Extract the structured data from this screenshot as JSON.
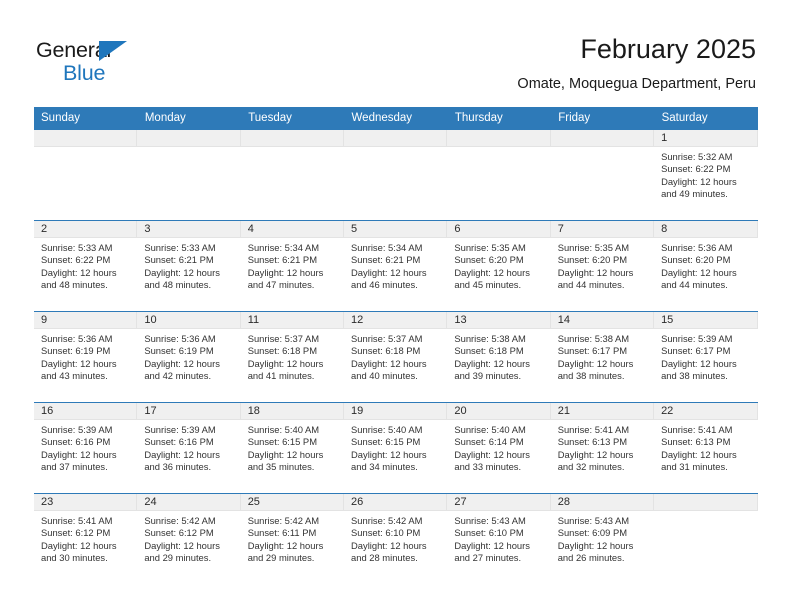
{
  "logo": {
    "primary_text": "General",
    "secondary_text": "Blue",
    "triangle_icon": "triangle-icon",
    "primary_color": "#1a1a1a",
    "accent_color": "#1f76bc"
  },
  "header": {
    "title": "February 2025",
    "subtitle": "Omate, Moquegua Department, Peru"
  },
  "theme": {
    "header_blue": "#2e7ab8",
    "daynum_band": "#f0f0f0",
    "cell_background": "#ffffff",
    "text_color": "#333333"
  },
  "calendar": {
    "weekday_headers": [
      "Sunday",
      "Monday",
      "Tuesday",
      "Wednesday",
      "Thursday",
      "Friday",
      "Saturday"
    ],
    "labels": {
      "sunrise": "Sunrise:",
      "sunset": "Sunset:",
      "daylight": "Daylight:"
    },
    "weeks": [
      [
        {
          "day": "",
          "info": ""
        },
        {
          "day": "",
          "info": ""
        },
        {
          "day": "",
          "info": ""
        },
        {
          "day": "",
          "info": ""
        },
        {
          "day": "",
          "info": ""
        },
        {
          "day": "",
          "info": ""
        },
        {
          "day": "1",
          "info": "Sunrise: 5:32 AM\nSunset: 6:22 PM\nDaylight: 12 hours\nand 49 minutes."
        }
      ],
      [
        {
          "day": "2",
          "info": "Sunrise: 5:33 AM\nSunset: 6:22 PM\nDaylight: 12 hours\nand 48 minutes."
        },
        {
          "day": "3",
          "info": "Sunrise: 5:33 AM\nSunset: 6:21 PM\nDaylight: 12 hours\nand 48 minutes."
        },
        {
          "day": "4",
          "info": "Sunrise: 5:34 AM\nSunset: 6:21 PM\nDaylight: 12 hours\nand 47 minutes."
        },
        {
          "day": "5",
          "info": "Sunrise: 5:34 AM\nSunset: 6:21 PM\nDaylight: 12 hours\nand 46 minutes."
        },
        {
          "day": "6",
          "info": "Sunrise: 5:35 AM\nSunset: 6:20 PM\nDaylight: 12 hours\nand 45 minutes."
        },
        {
          "day": "7",
          "info": "Sunrise: 5:35 AM\nSunset: 6:20 PM\nDaylight: 12 hours\nand 44 minutes."
        },
        {
          "day": "8",
          "info": "Sunrise: 5:36 AM\nSunset: 6:20 PM\nDaylight: 12 hours\nand 44 minutes."
        }
      ],
      [
        {
          "day": "9",
          "info": "Sunrise: 5:36 AM\nSunset: 6:19 PM\nDaylight: 12 hours\nand 43 minutes."
        },
        {
          "day": "10",
          "info": "Sunrise: 5:36 AM\nSunset: 6:19 PM\nDaylight: 12 hours\nand 42 minutes."
        },
        {
          "day": "11",
          "info": "Sunrise: 5:37 AM\nSunset: 6:18 PM\nDaylight: 12 hours\nand 41 minutes."
        },
        {
          "day": "12",
          "info": "Sunrise: 5:37 AM\nSunset: 6:18 PM\nDaylight: 12 hours\nand 40 minutes."
        },
        {
          "day": "13",
          "info": "Sunrise: 5:38 AM\nSunset: 6:18 PM\nDaylight: 12 hours\nand 39 minutes."
        },
        {
          "day": "14",
          "info": "Sunrise: 5:38 AM\nSunset: 6:17 PM\nDaylight: 12 hours\nand 38 minutes."
        },
        {
          "day": "15",
          "info": "Sunrise: 5:39 AM\nSunset: 6:17 PM\nDaylight: 12 hours\nand 38 minutes."
        }
      ],
      [
        {
          "day": "16",
          "info": "Sunrise: 5:39 AM\nSunset: 6:16 PM\nDaylight: 12 hours\nand 37 minutes."
        },
        {
          "day": "17",
          "info": "Sunrise: 5:39 AM\nSunset: 6:16 PM\nDaylight: 12 hours\nand 36 minutes."
        },
        {
          "day": "18",
          "info": "Sunrise: 5:40 AM\nSunset: 6:15 PM\nDaylight: 12 hours\nand 35 minutes."
        },
        {
          "day": "19",
          "info": "Sunrise: 5:40 AM\nSunset: 6:15 PM\nDaylight: 12 hours\nand 34 minutes."
        },
        {
          "day": "20",
          "info": "Sunrise: 5:40 AM\nSunset: 6:14 PM\nDaylight: 12 hours\nand 33 minutes."
        },
        {
          "day": "21",
          "info": "Sunrise: 5:41 AM\nSunset: 6:13 PM\nDaylight: 12 hours\nand 32 minutes."
        },
        {
          "day": "22",
          "info": "Sunrise: 5:41 AM\nSunset: 6:13 PM\nDaylight: 12 hours\nand 31 minutes."
        }
      ],
      [
        {
          "day": "23",
          "info": "Sunrise: 5:41 AM\nSunset: 6:12 PM\nDaylight: 12 hours\nand 30 minutes."
        },
        {
          "day": "24",
          "info": "Sunrise: 5:42 AM\nSunset: 6:12 PM\nDaylight: 12 hours\nand 29 minutes."
        },
        {
          "day": "25",
          "info": "Sunrise: 5:42 AM\nSunset: 6:11 PM\nDaylight: 12 hours\nand 29 minutes."
        },
        {
          "day": "26",
          "info": "Sunrise: 5:42 AM\nSunset: 6:10 PM\nDaylight: 12 hours\nand 28 minutes."
        },
        {
          "day": "27",
          "info": "Sunrise: 5:43 AM\nSunset: 6:10 PM\nDaylight: 12 hours\nand 27 minutes."
        },
        {
          "day": "28",
          "info": "Sunrise: 5:43 AM\nSunset: 6:09 PM\nDaylight: 12 hours\nand 26 minutes."
        },
        {
          "day": "",
          "info": ""
        }
      ]
    ]
  }
}
